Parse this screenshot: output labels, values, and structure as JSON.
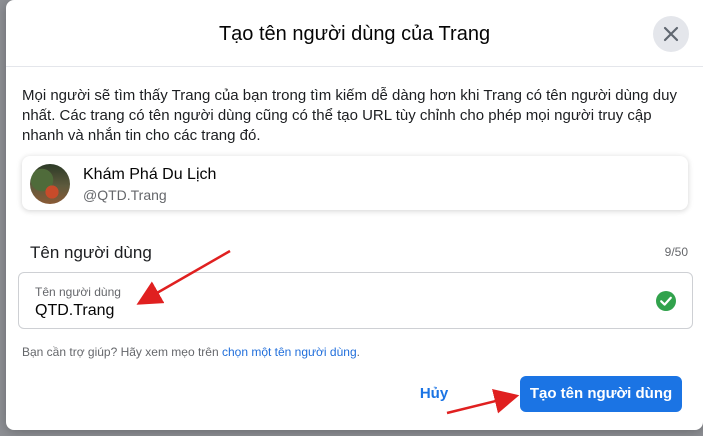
{
  "dialog": {
    "title": "Tạo tên người dùng của Trang",
    "description": "Mọi người sẽ tìm thấy Trang của bạn trong tìm kiếm dễ dàng hơn khi Trang có tên người dùng duy nhất. Các trang có tên người dùng cũng có thể tạo URL tùy chỉnh cho phép mọi người truy cập nhanh và nhắn tin cho các trang đó."
  },
  "page": {
    "name": "Khám Phá Du Lịch",
    "handle": "@QTD.Trang"
  },
  "username_field": {
    "label": "Tên người dùng",
    "count": "9/50",
    "inner_label": "Tên người dùng",
    "value": "QTD.Trang"
  },
  "help": {
    "text": "Bạn cần trợ giúp? Hãy xem mẹo trên ",
    "link": "chọn một tên người dùng",
    "suffix": "."
  },
  "buttons": {
    "cancel": "Hủy",
    "create": "Tạo tên người dùng"
  },
  "icons": {
    "close": "close-icon",
    "check": "check-circle-icon"
  },
  "colors": {
    "primary": "#1b74e4",
    "success": "#31a24c",
    "annotation_arrow": "#e02020"
  }
}
